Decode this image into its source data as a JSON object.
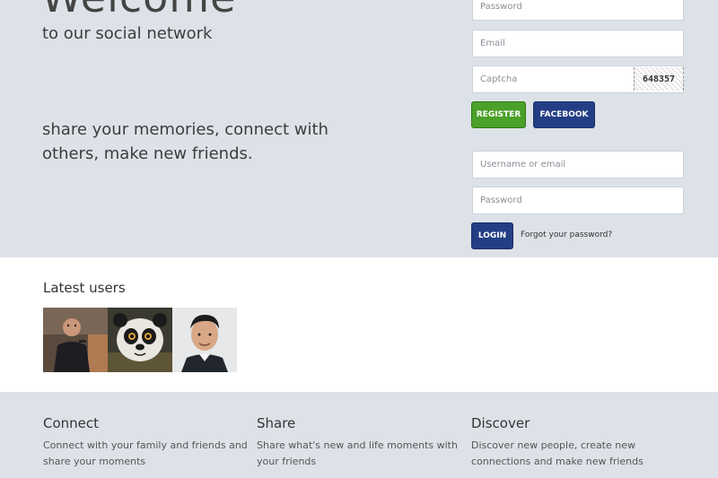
{
  "hero": {
    "welcome": "Welcome",
    "tagline": "to our social network",
    "pitch": "share your memories, connect with others, make new friends."
  },
  "register": {
    "password_placeholder": "Password",
    "email_placeholder": "Email",
    "captcha_placeholder": "Captcha",
    "captcha_code": "648357",
    "register_label": "REGISTER",
    "facebook_label": "FACEBOOK"
  },
  "login": {
    "username_placeholder": "Username or email",
    "password_placeholder": "Password",
    "login_label": "LOGIN",
    "forgot_label": "Forgot your password?"
  },
  "latest_users": {
    "title": "Latest users"
  },
  "features": [
    {
      "title": "Connect",
      "text": "Connect with your family and friends and share your moments"
    },
    {
      "title": "Share",
      "text": "Share what's new and life moments with your friends"
    },
    {
      "title": "Discover",
      "text": "Discover new people, create new connections and make new friends"
    }
  ],
  "colors": {
    "hero_bg": "#dde2e8",
    "register_green": "#4aa028",
    "brand_blue": "#233e85"
  }
}
